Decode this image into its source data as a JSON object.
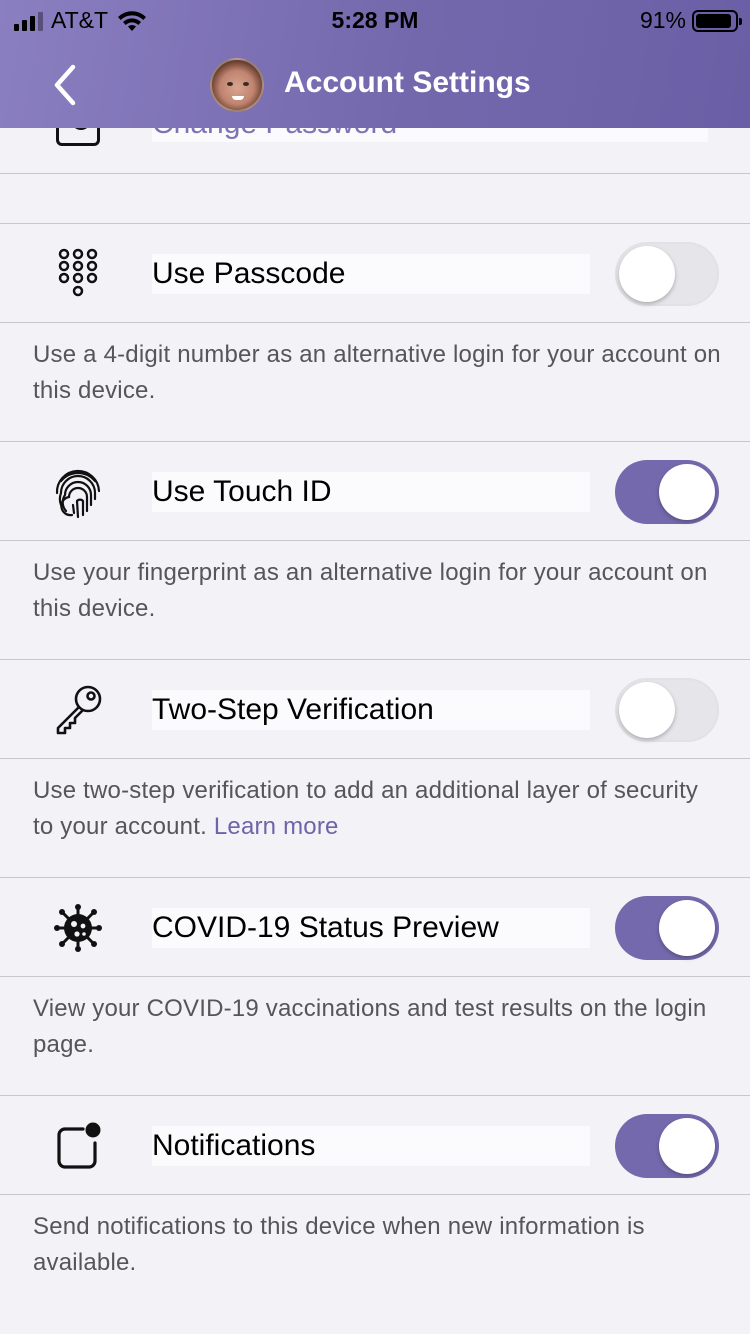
{
  "status_bar": {
    "carrier": "AT&T",
    "time": "5:28 PM",
    "battery": "91%",
    "battery_level": 0.91,
    "signal_bars": 3,
    "signal_icon": "signal-icon",
    "wifi_icon": "wifi-icon",
    "battery_icon": "battery-icon"
  },
  "nav": {
    "title": "Account Settings",
    "back_icon": "chevron-left-icon"
  },
  "partial_row": {
    "label": "Change Password",
    "icon": "camera-icon"
  },
  "settings": [
    {
      "icon": "keypad-icon",
      "label": "Use Passcode",
      "enabled": false,
      "description": "Use a 4-digit number as an alternative login for your account on this device."
    },
    {
      "icon": "fingerprint-icon",
      "label": "Use Touch ID",
      "enabled": true,
      "description": "Use your fingerprint as an alternative login for your account on this device."
    },
    {
      "icon": "key-icon",
      "label": "Two-Step Verification",
      "enabled": false,
      "description": "Use two-step verification to add an additional layer of security to your account.",
      "link": "Learn more"
    },
    {
      "icon": "virus-icon",
      "label": "COVID-19 Status Preview",
      "enabled": true,
      "description": "View your COVID-19 vaccinations and test results on the login page."
    },
    {
      "icon": "notification-badge-icon",
      "label": "Notifications",
      "enabled": true,
      "description": "Send notifications to this device when new information is available."
    }
  ],
  "colors": {
    "accent": "#7469ad",
    "header_gradient_start": "#8a7fc0",
    "header_gradient_end": "#6a5ea6",
    "background": "#f2f2f7",
    "link": "#6f64a8"
  }
}
